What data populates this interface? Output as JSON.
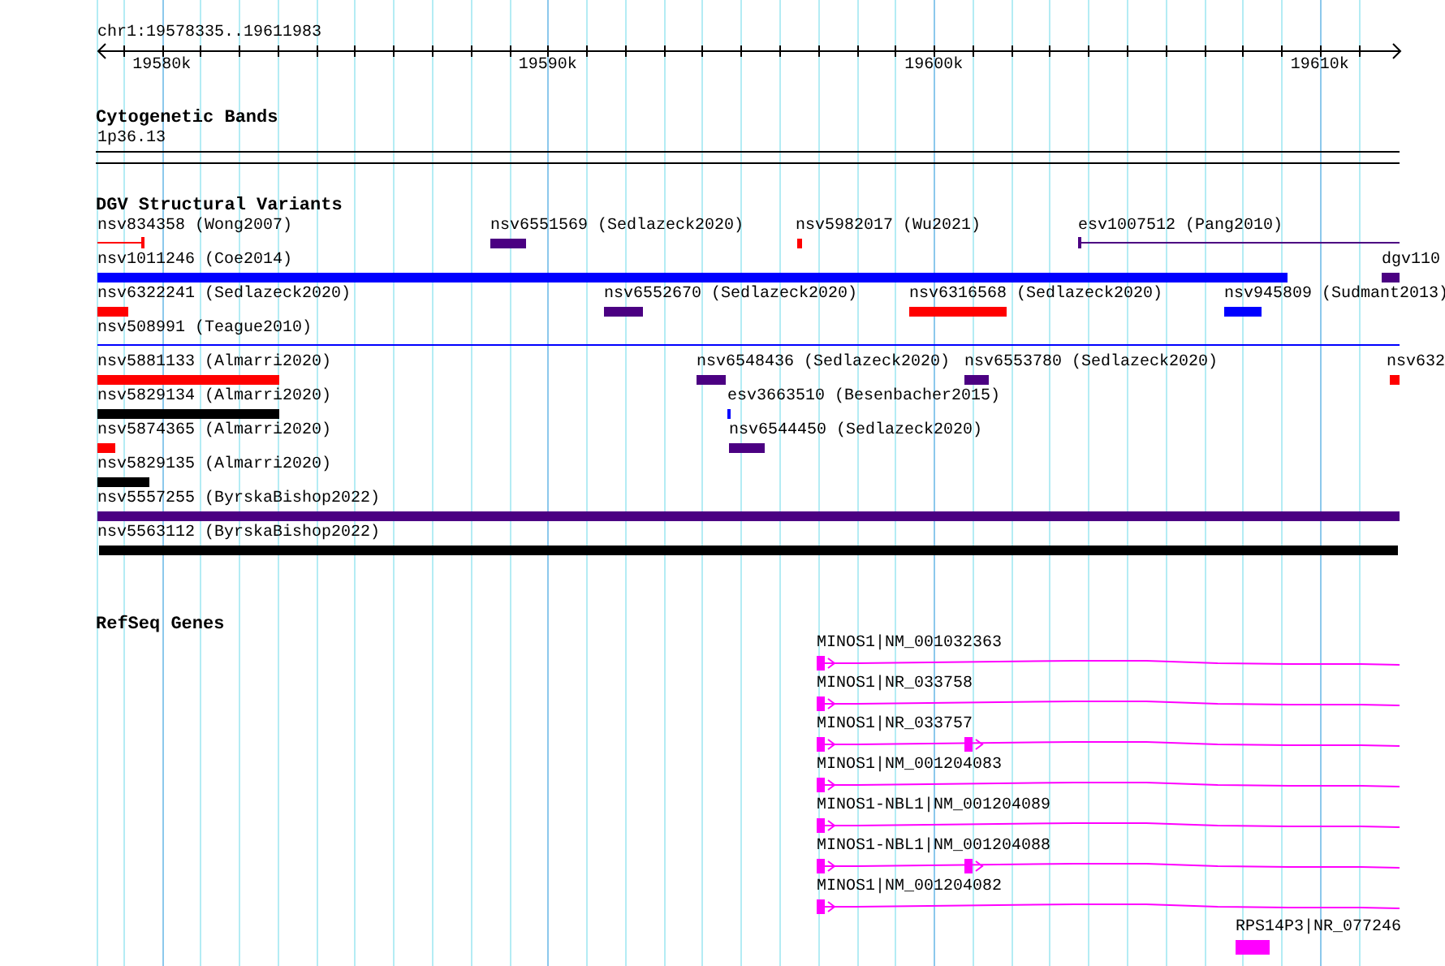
{
  "axis": {
    "location": "chr1:19578335..19611983",
    "ticks": [
      "19580k",
      "19590k",
      "19600k",
      "19610k"
    ]
  },
  "tracks": [
    {
      "title": "Cytogenetic Bands",
      "kind": "bands",
      "features": [
        {
          "label": "1p36.13"
        }
      ]
    },
    {
      "title": "DGV Structural Variants",
      "kind": "variants",
      "features": [
        {
          "label": "nsv834358 (Wong2007)",
          "kind": "line",
          "color": "#ff0000"
        },
        {
          "label": "nsv6551569 (Sedlazeck2020)",
          "kind": "bar",
          "color": "#4b0082"
        },
        {
          "label": "nsv5982017 (Wu2021)",
          "kind": "bar",
          "color": "#ff0000"
        },
        {
          "label": "esv1007512 (Pang2010)",
          "kind": "line",
          "color": "#4b0082"
        },
        {
          "label": "nsv1011246 (Coe2014)",
          "kind": "bar",
          "color": "#0000ff"
        },
        {
          "label": "dgv110",
          "kind": "bar",
          "color": "#4b0082"
        },
        {
          "label": "nsv6322241 (Sedlazeck2020)",
          "kind": "bar",
          "color": "#ff0000"
        },
        {
          "label": "nsv6552670 (Sedlazeck2020)",
          "kind": "bar",
          "color": "#4b0082"
        },
        {
          "label": "nsv6316568 (Sedlazeck2020)",
          "kind": "bar",
          "color": "#ff0000"
        },
        {
          "label": "nsv945809 (Sudmant2013)",
          "kind": "bar",
          "color": "#0000ff"
        },
        {
          "label": "nsv508991 (Teague2010)",
          "kind": "line",
          "color": "#0000ff"
        },
        {
          "label": "nsv5881133 (Almarri2020)",
          "kind": "bar",
          "color": "#ff0000"
        },
        {
          "label": "nsv6548436 (Sedlazeck2020)",
          "kind": "bar",
          "color": "#4b0082"
        },
        {
          "label": "nsv6553780 (Sedlazeck2020)",
          "kind": "bar",
          "color": "#4b0082"
        },
        {
          "label": "nsv632",
          "kind": "bar",
          "color": "#ff0000"
        },
        {
          "label": "nsv5829134 (Almarri2020)",
          "kind": "bar",
          "color": "#000000"
        },
        {
          "label": "esv3663510 (Besenbacher2015)",
          "kind": "bar",
          "color": "#0000ff"
        },
        {
          "label": "nsv5874365 (Almarri2020)",
          "kind": "bar",
          "color": "#ff0000"
        },
        {
          "label": "nsv6544450 (Sedlazeck2020)",
          "kind": "bar",
          "color": "#4b0082"
        },
        {
          "label": "nsv5829135 (Almarri2020)",
          "kind": "bar",
          "color": "#000000"
        },
        {
          "label": "nsv5557255 (ByrskaBishop2022)",
          "kind": "bar",
          "color": "#4b0082"
        },
        {
          "label": "nsv5563112 (ByrskaBishop2022)",
          "kind": "bar",
          "color": "#000000"
        }
      ]
    },
    {
      "title": "RefSeq Genes",
      "kind": "genes",
      "features": [
        {
          "label": "MINOS1|NM_001032363",
          "kind": "transcript"
        },
        {
          "label": "MINOS1|NR_033758",
          "kind": "transcript"
        },
        {
          "label": "MINOS1|NR_033757",
          "kind": "transcript"
        },
        {
          "label": "MINOS1|NM_001204083",
          "kind": "transcript"
        },
        {
          "label": "MINOS1-NBL1|NM_001204089",
          "kind": "transcript"
        },
        {
          "label": "MINOS1-NBL1|NM_001204088",
          "kind": "transcript"
        },
        {
          "label": "MINOS1|NM_001204082",
          "kind": "transcript"
        },
        {
          "label": "RPS14P3|NR_077246",
          "kind": "block"
        }
      ]
    }
  ]
}
